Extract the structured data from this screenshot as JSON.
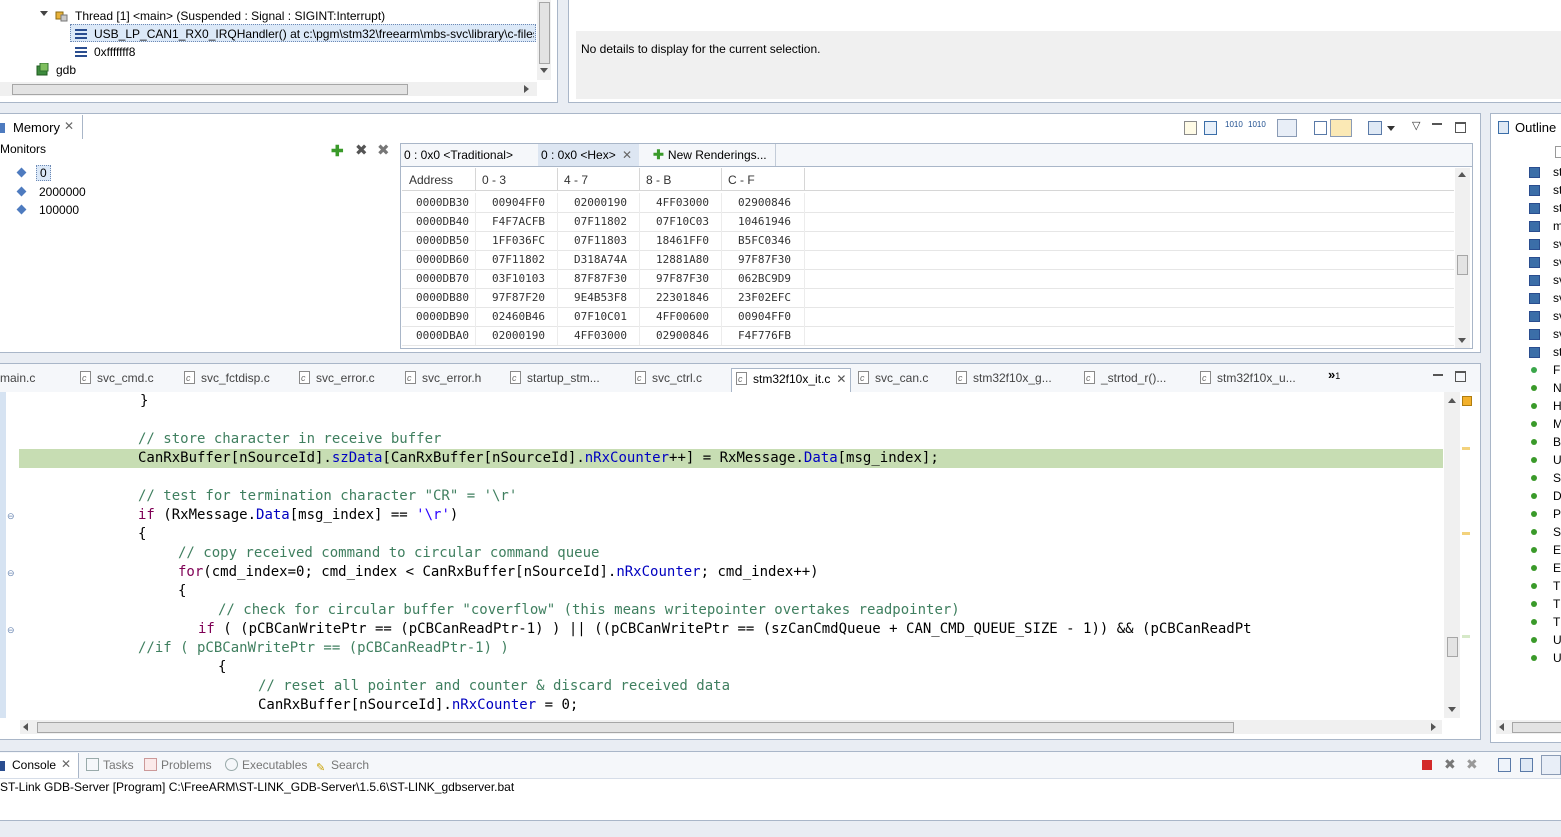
{
  "debug_tree": {
    "thread_label": "Thread [1] <main> (Suspended : Signal : SIGINT:Interrupt)",
    "frame_selected": "USB_LP_CAN1_RX0_IRQHandler() at c:\\pgm\\stm32\\freearm\\mbs-svc\\library\\c-files\\",
    "frame_2": "0xfffffff8",
    "gdb_label": "gdb"
  },
  "details_panel": {
    "message": "No details to display for the current selection."
  },
  "memory_view": {
    "tab_title": "Memory",
    "monitors_label": "Monitors",
    "monitors": [
      "0",
      "2000000",
      "100000"
    ],
    "render_tabs": [
      "0 : 0x0 <Traditional>",
      "0 : 0x0 <Hex>",
      "New Renderings..."
    ],
    "columns": [
      "Address",
      "0 - 3",
      "4 - 7",
      "8 - B",
      "C - F"
    ],
    "rows": [
      [
        "0000DB30",
        "00904FF0",
        "02000190",
        "4FF03000",
        "02900846"
      ],
      [
        "0000DB40",
        "F4F7ACFB",
        "07F11802",
        "07F10C03",
        "10461946"
      ],
      [
        "0000DB50",
        "1FF036FC",
        "07F11803",
        "18461FF0",
        "B5FC0346"
      ],
      [
        "0000DB60",
        "07F11802",
        "D318A74A",
        "12881A80",
        "97F87F30"
      ],
      [
        "0000DB70",
        "03F10103",
        "87F87F30",
        "97F87F30",
        "062BC9D9"
      ],
      [
        "0000DB80",
        "97F87F20",
        "9E4B53F8",
        "22301846",
        "23F02EFC"
      ],
      [
        "0000DB90",
        "02460B46",
        "07F10C01",
        "4FF00600",
        "00904FF0"
      ],
      [
        "0000DBA0",
        "02000190",
        "4FF03000",
        "02900846",
        "F4F776FB"
      ]
    ]
  },
  "outline_view": {
    "tab_title": "Outline",
    "items": [
      "st",
      "st",
      "st",
      "m",
      "sv",
      "sv",
      "sv",
      "sv",
      "sv",
      "sv",
      "st",
      "Fi",
      "N",
      "H",
      "M",
      "Bu",
      "U",
      "SV",
      "D",
      "Pe",
      "Sy",
      "EX",
      "EX",
      "TI",
      "TI",
      "TI",
      "U",
      "U"
    ]
  },
  "editor": {
    "tabs": [
      "main.c",
      "svc_cmd.c",
      "svc_fctdisp.c",
      "svc_error.c",
      "svc_error.h",
      "startup_stm...",
      "svc_ctrl.c",
      "stm32f10x_it.c",
      "svc_can.c",
      "stm32f10x_g...",
      "_strtod_r()...",
      "stm32f10x_u..."
    ],
    "active_tab": "stm32f10x_it.c",
    "overflow_count": "1",
    "lines": {
      "l1": "}",
      "l2": "// store character in receive buffer",
      "l3_a": "CanRxBuffer[nSourceId].",
      "l3_b": "szData",
      "l3_c": "[CanRxBuffer[nSourceId].",
      "l3_d": "nRxCounter",
      "l3_e": "++] = RxMessage.",
      "l3_f": "Data",
      "l3_g": "[msg_index];",
      "l4": "// test for termination character \"CR\" = '\\r'",
      "l5_kw": "if",
      "l5_a": " (RxMessage.",
      "l5_b": "Data",
      "l5_c": "[msg_index] == ",
      "l5_str": "'\\r'",
      "l5_d": ")",
      "l6": "{",
      "l7": "// copy received command to circular command queue",
      "l8_kw": "for",
      "l8_a": "(cmd_index=0; cmd_index < CanRxBuffer[nSourceId].",
      "l8_b": "nRxCounter",
      "l8_c": "; cmd_index++)",
      "l9": "{",
      "l10": "// check for circular buffer \"coverflow\" (this means writepointer overtakes readpointer)",
      "l11_kw": "if",
      "l11_a": " ( (pCBCanWritePtr == (pCBCanReadPtr-1) ) || ((pCBCanWritePtr == (szCanCmdQueue + CAN_CMD_QUEUE_SIZE - 1)) && (pCBCanReadPt",
      "l12": "//if ( pCBCanWritePtr == (pCBCanReadPtr-1) )",
      "l13": "{",
      "l14": "// reset all pointer and counter & discard received data",
      "l15_a": "CanRxBuffer[nSourceId].",
      "l15_b": "nRxCounter",
      "l15_c": " = 0;"
    }
  },
  "console": {
    "tabs": [
      "Console",
      "Tasks",
      "Problems",
      "Executables",
      "Search"
    ],
    "process_line": "ST-Link GDB-Server [Program] C:\\FreeARM\\ST-LINK_GDB-Server\\1.5.6\\ST-LINK_gdbserver.bat"
  }
}
